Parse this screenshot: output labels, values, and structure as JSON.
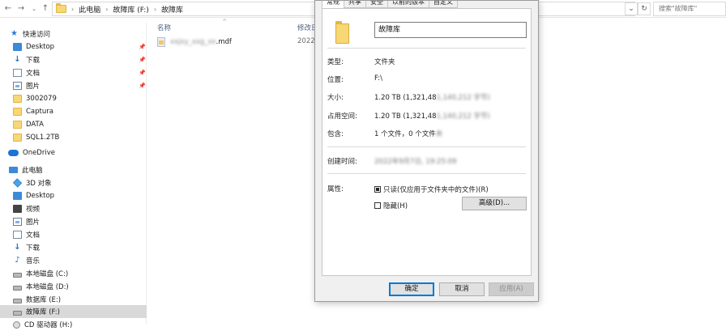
{
  "address_bar": {
    "back_icon": "arrow-left-icon",
    "forward_icon": "arrow-right-icon",
    "history_icon": "chevron-down-icon",
    "up_icon": "arrow-up-icon",
    "path": [
      "此电脑",
      "故障库 (F:)",
      "故障库"
    ],
    "search_placeholder": "搜索\"故障库\""
  },
  "sidebar": {
    "items": [
      {
        "label": "快速访问",
        "icon": "star-icon"
      },
      {
        "label": "Desktop",
        "icon": "desktop-icon",
        "pinned": true
      },
      {
        "label": "下载",
        "icon": "download-icon",
        "pinned": true
      },
      {
        "label": "文档",
        "icon": "document-icon",
        "pinned": true
      },
      {
        "label": "图片",
        "icon": "picture-icon",
        "pinned": true
      },
      {
        "label": "3002079",
        "icon": "folder-icon"
      },
      {
        "label": "Captura",
        "icon": "folder-icon"
      },
      {
        "label": "DATA",
        "icon": "folder-icon"
      },
      {
        "label": "SQL1.2TB",
        "icon": "folder-icon"
      },
      {
        "label": "OneDrive",
        "icon": "cloud-icon"
      },
      {
        "label": "此电脑",
        "icon": "computer-icon"
      },
      {
        "label": "3D 对象",
        "icon": "cube-icon"
      },
      {
        "label": "Desktop",
        "icon": "desktop-icon"
      },
      {
        "label": "视频",
        "icon": "video-icon"
      },
      {
        "label": "图片",
        "icon": "picture-icon"
      },
      {
        "label": "文档",
        "icon": "document-icon"
      },
      {
        "label": "下载",
        "icon": "download-icon"
      },
      {
        "label": "音乐",
        "icon": "music-icon"
      },
      {
        "label": "本地磁盘 (C:)",
        "icon": "drive-icon"
      },
      {
        "label": "本地磁盘 (D:)",
        "icon": "drive-icon"
      },
      {
        "label": "数据库 (E:)",
        "icon": "drive-icon"
      },
      {
        "label": "故障库 (F:)",
        "icon": "drive-icon",
        "selected": true
      },
      {
        "label": "CD 驱动器 (H:)",
        "icon": "cd-icon"
      }
    ]
  },
  "file_list": {
    "columns": {
      "name": "名称",
      "modified": "修改日"
    },
    "rows": [
      {
        "name_blurred": "xxjxy_xxg_xx",
        "ext": ".mdf",
        "date": "2022/"
      }
    ]
  },
  "dialog": {
    "tabs": [
      {
        "label": "常规",
        "active": true
      },
      {
        "label": "共享"
      },
      {
        "label": "安全"
      },
      {
        "label": "以前的版本"
      },
      {
        "label": "自定义"
      }
    ],
    "folder_name": "故障库",
    "props": {
      "type_label": "类型:",
      "type_value": "文件夹",
      "location_label": "位置:",
      "location_value": "F:\\",
      "size_label": "大小:",
      "size_value": "1.20 TB (1,321,48",
      "size_blur": "1,140,212 字节)",
      "disk_label": "占用空间:",
      "disk_value": "1.20 TB (1,321,48",
      "disk_blur": "1,140,212 字节)",
      "contains_label": "包含:",
      "contains_value": "1 个文件，0 个文件",
      "contains_blur": "夹",
      "created_label": "创建时间:",
      "created_blur": "2022年9月7日, 19:25:09",
      "attrs_label": "属性:",
      "readonly_label": "只读(仅应用于文件夹中的文件)(R)",
      "hidden_label": "隐藏(H)",
      "advanced_label": "高级(D)..."
    },
    "buttons": {
      "ok": "确定",
      "cancel": "取消",
      "apply": "应用(A)"
    }
  }
}
